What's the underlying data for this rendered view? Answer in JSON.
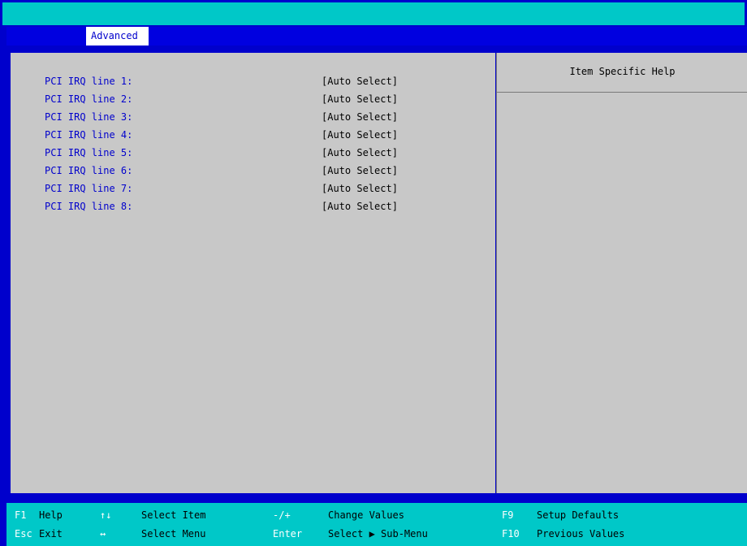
{
  "menu": {
    "tabs": [
      {
        "label": "Advanced",
        "active": true
      }
    ]
  },
  "help_panel": {
    "title": "Item Specific Help"
  },
  "settings": [
    {
      "label": "PCI IRQ line 1:",
      "value": "[Auto Select]"
    },
    {
      "label": "PCI IRQ line 2:",
      "value": "[Auto Select]"
    },
    {
      "label": "PCI IRQ line 3:",
      "value": "[Auto Select]"
    },
    {
      "label": "PCI IRQ line 4:",
      "value": "[Auto Select]"
    },
    {
      "label": "PCI IRQ line 5:",
      "value": "[Auto Select]"
    },
    {
      "label": "PCI IRQ line 6:",
      "value": "[Auto Select]"
    },
    {
      "label": "PCI IRQ line 7:",
      "value": "[Auto Select]"
    },
    {
      "label": "PCI IRQ line 8:",
      "value": "[Auto Select]"
    }
  ],
  "footer": {
    "keys": [
      {
        "key": "F1",
        "desc": "Help"
      },
      {
        "key": "Esc",
        "desc": "Exit"
      },
      {
        "key": "↑↓",
        "desc": "Select Item"
      },
      {
        "key": "↔",
        "desc": "Select Menu"
      },
      {
        "key": "-/+",
        "desc": "Change Values"
      },
      {
        "key": "Enter",
        "desc": "Select ▶ Sub-Menu"
      },
      {
        "key": "F9",
        "desc": "Setup Defaults"
      },
      {
        "key": "F10",
        "desc": "Previous Values"
      }
    ]
  },
  "colors": {
    "frame": "#0000cc",
    "band": "#00c8c8",
    "panel": "#c8c8c8",
    "label_blue": "#0000cc"
  }
}
